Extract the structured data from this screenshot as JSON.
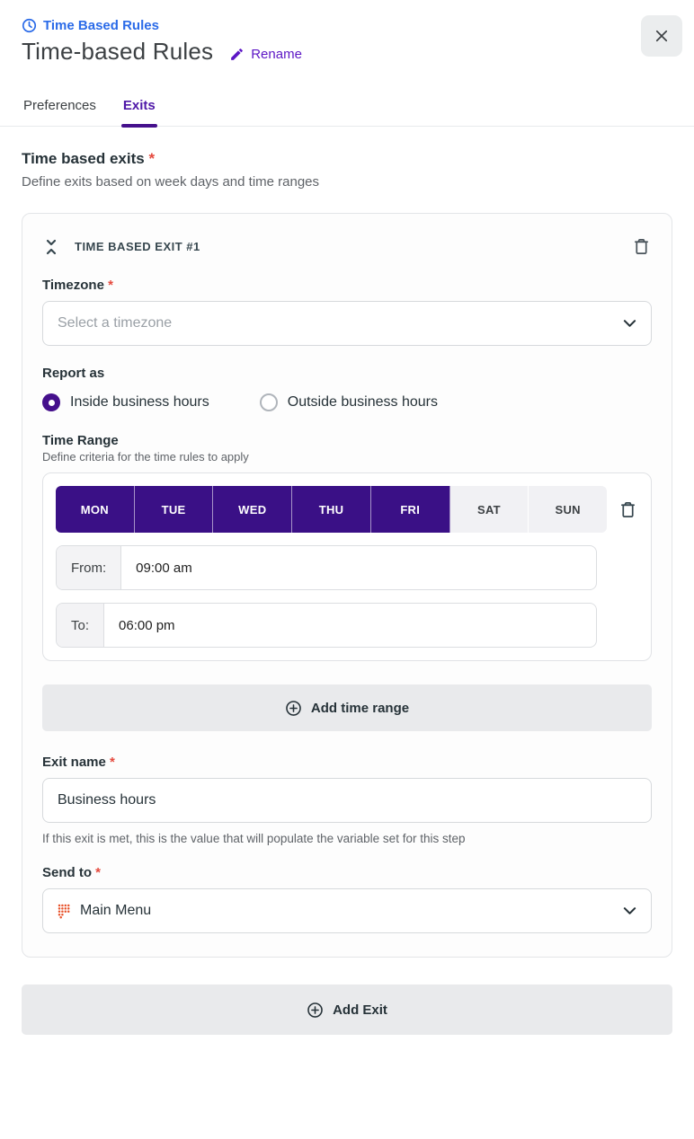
{
  "header": {
    "breadcrumb": "Time Based Rules",
    "title": "Time-based Rules",
    "rename_label": "Rename"
  },
  "tabs": [
    {
      "label": "Preferences",
      "active": false
    },
    {
      "label": "Exits",
      "active": true
    }
  ],
  "section": {
    "title": "Time based exits",
    "required_mark": "*",
    "subtitle": "Define exits based on week days and time ranges"
  },
  "exit_card": {
    "header": "TIME BASED EXIT #1",
    "timezone": {
      "label": "Timezone",
      "required_mark": "*",
      "placeholder": "Select a timezone"
    },
    "report_as": {
      "label": "Report as",
      "options": [
        {
          "label": "Inside business hours",
          "selected": true
        },
        {
          "label": "Outside business hours",
          "selected": false
        }
      ]
    },
    "time_range": {
      "label": "Time Range",
      "subtitle": "Define criteria for the time rules to apply",
      "days": [
        {
          "label": "MON",
          "selected": true
        },
        {
          "label": "TUE",
          "selected": true
        },
        {
          "label": "WED",
          "selected": true
        },
        {
          "label": "THU",
          "selected": true
        },
        {
          "label": "FRI",
          "selected": true
        },
        {
          "label": "SAT",
          "selected": false
        },
        {
          "label": "SUN",
          "selected": false
        }
      ],
      "from": {
        "label": "From:",
        "value": "09:00 am"
      },
      "to": {
        "label": "To:",
        "value": "06:00 pm"
      }
    },
    "add_time_range_label": "Add time range",
    "exit_name": {
      "label": "Exit name",
      "required_mark": "*",
      "value": "Business hours",
      "helper": "If this exit is met, this is the value that will populate the variable set for this step"
    },
    "send_to": {
      "label": "Send to",
      "required_mark": "*",
      "value": "Main Menu"
    }
  },
  "add_exit_label": "Add Exit",
  "colors": {
    "breadcrumb_blue": "#2b6be8",
    "accent_purple": "#5c16c5",
    "tab_underline_purple": "#45108c",
    "day_selected_purple": "#3a1086",
    "required_red": "#e5493d",
    "send_to_icon_orange": "#e8552e"
  }
}
